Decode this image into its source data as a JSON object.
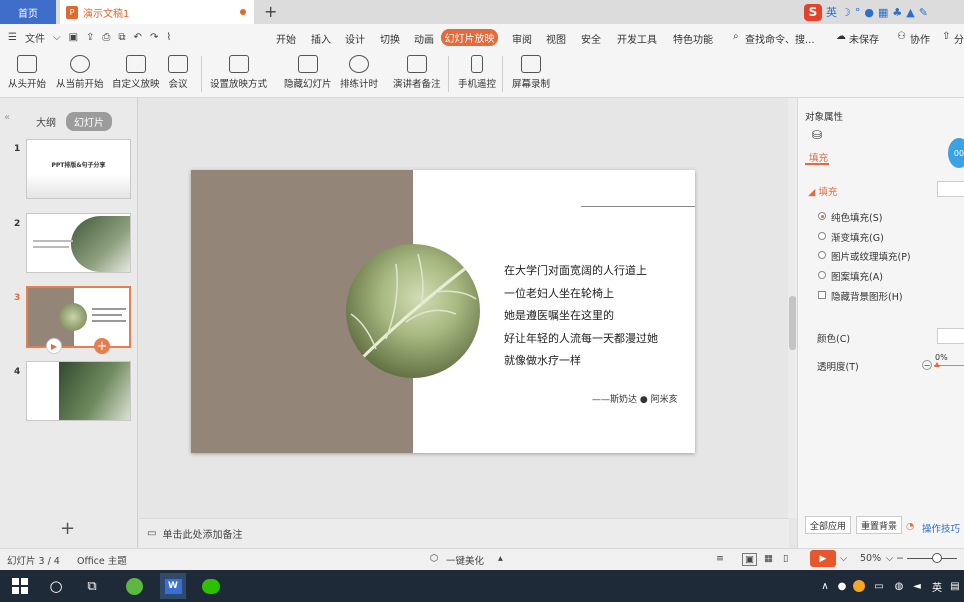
{
  "tabs": {
    "home": "首页",
    "doc": "演示文稿1",
    "add": "+"
  },
  "ime": {
    "logo": "S",
    "lang": "英",
    "icons": [
      "☽",
      "°",
      "🎤",
      "⌨",
      "♣",
      "👕",
      "🔧"
    ]
  },
  "menu": {
    "file": "文件",
    "tabs": [
      "开始",
      "插入",
      "设计",
      "切换",
      "动画",
      "幻灯片放映",
      "审阅",
      "视图",
      "安全",
      "开发工具",
      "特色功能"
    ],
    "search": "查找命令、搜...",
    "unsaved": "未保存",
    "collab": "协作",
    "share": "分"
  },
  "ribbon": [
    "从头开始",
    "从当前开始",
    "自定义放映",
    "会议",
    "设置放映方式",
    "隐藏幻灯片",
    "排练计时",
    "演讲者备注",
    "手机遥控",
    "屏幕录制"
  ],
  "view": {
    "outline": "大纲",
    "slides": "幻灯片"
  },
  "thumbs": {
    "nums": [
      "1",
      "2",
      "3",
      "4"
    ],
    "t1_title": "PPT排版&句子分享"
  },
  "slide": {
    "lines": [
      "在大学门对面宽阔的人行道上",
      "一位老妇人坐在轮椅上",
      "她是遵医嘱坐在这里的",
      "好让年轻的人流每一天都漫过她",
      "就像做水疗一样"
    ],
    "author": "——斯奶达 ● 阿米亥"
  },
  "notes": "单击此处添加备注",
  "panel": {
    "title": "对象属性",
    "fill_tab": "填充",
    "section": "填充",
    "options": [
      "纯色填充(S)",
      "渐变填充(G)",
      "图片或纹理填充(P)",
      "图案填充(A)"
    ],
    "hide_bg": "隐藏背景图形(H)",
    "color": "颜色(C)",
    "transparency": "透明度(T)",
    "trans_value": "0%",
    "apply_all": "全部应用",
    "reset_bg": "重置背景",
    "tips": "操作技巧",
    "badge": "00"
  },
  "status": {
    "slide_info": "幻灯片 3 / 4",
    "theme": "Office 主题",
    "beautify": "一键美化",
    "zoom": "50%"
  },
  "taskbar": {
    "ime": "英"
  }
}
